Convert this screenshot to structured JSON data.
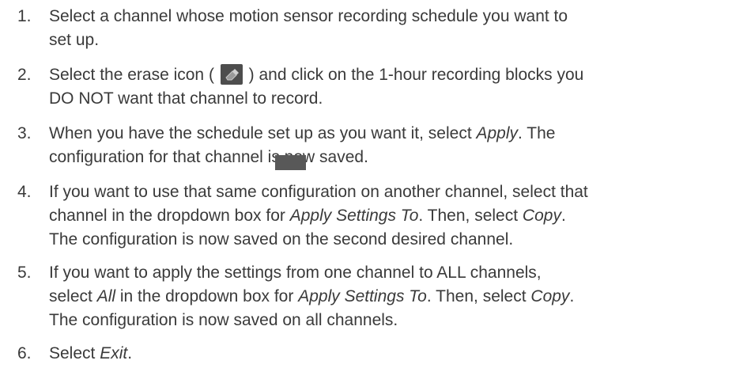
{
  "steps": [
    {
      "number": "1.",
      "line1": "Select a channel whose motion sensor recording schedule you want to",
      "line2": "set up."
    },
    {
      "number": "2.",
      "line1_a": "Select the erase icon (",
      "line1_b": ") and click on the 1-hour recording blocks you",
      "line2": "DO NOT want that channel to record.",
      "icon": "erase-icon"
    },
    {
      "number": "3.",
      "line1_a": "When you have the schedule set up as you want it, select ",
      "line1_em": "Apply",
      "line1_b": ". The",
      "line2": "configuration for that channel is now saved."
    },
    {
      "number": "4.",
      "line1": "If you want to use that same configuration on another channel, select that",
      "line2_a": "channel in the dropdown box for ",
      "line2_em1": "Apply Settings To",
      "line2_b": ". Then, select ",
      "line2_em2": "Copy",
      "line2_c": ".",
      "line3": "The configuration is now saved on the second desired channel."
    },
    {
      "number": "5.",
      "line1": "If you want to apply the settings from one channel to ALL channels,",
      "line2_a": "select ",
      "line2_em1": "All",
      "line2_b": " in the dropdown box for ",
      "line2_em2": "Apply Settings To",
      "line2_c": ". Then, select ",
      "line2_em3": "Copy",
      "line2_d": ".",
      "line3": "The configuration is now saved on all channels."
    },
    {
      "number": "6.",
      "line1_a": "Select ",
      "line1_em": "Exit",
      "line1_b": "."
    }
  ]
}
